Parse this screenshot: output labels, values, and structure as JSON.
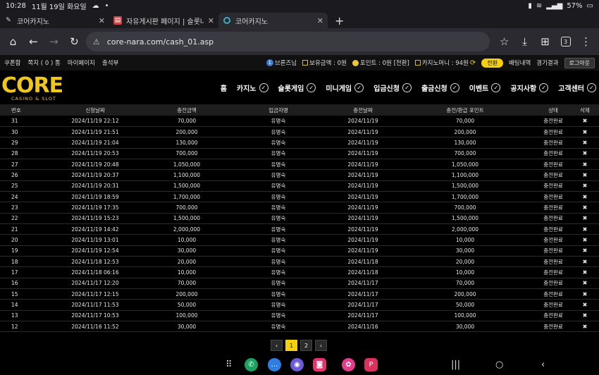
{
  "status": {
    "time": "10:28",
    "date": "11월 19일 화요일",
    "battery": "57%"
  },
  "tabs": [
    {
      "title": "코어카지노"
    },
    {
      "title": "자유게시판 페이지 | 슬롯나라 -"
    },
    {
      "title": "코어카지노"
    }
  ],
  "address": {
    "url": "core-nara.com/cash_01.asp",
    "tab_count": "3"
  },
  "sitebar": {
    "links": [
      "쿠폰함",
      "쪽지 ( 0 ) 통",
      "마이페이지",
      "출석부"
    ],
    "user": "브론즈님",
    "balance": "보유금액 : 0원",
    "points": "포인트 : 0원 [전환]",
    "casino_money": "카지노머니 : 94원",
    "convert": "전환",
    "bet_history": "배팅내역",
    "results": "경기결과",
    "logout": "로그아웃"
  },
  "logo": {
    "word": "CORE",
    "sub": "CASINO & SLOT"
  },
  "menu": [
    "홈",
    "카지노",
    "슬롯게임",
    "미니게임",
    "입금신청",
    "출금신청",
    "이벤트",
    "공지사항",
    "고객센터"
  ],
  "table": {
    "headers": [
      "번호",
      "신청날짜",
      "충전금액",
      "입금자명",
      "충전날짜",
      "충전/환급 포인트",
      "상태",
      "삭제"
    ],
    "rows": [
      {
        "no": "31",
        "req": "2024/11/19 22:12",
        "amount": "70,000",
        "name": "유명숙",
        "date": "2024/11/19",
        "point": "70,000",
        "status": "충전완료"
      },
      {
        "no": "30",
        "req": "2024/11/19 21:51",
        "amount": "200,000",
        "name": "유명숙",
        "date": "2024/11/19",
        "point": "200,000",
        "status": "충전완료"
      },
      {
        "no": "29",
        "req": "2024/11/19 21:04",
        "amount": "130,000",
        "name": "유명숙",
        "date": "2024/11/19",
        "point": "130,000",
        "status": "충전완료"
      },
      {
        "no": "28",
        "req": "2024/11/19 20:53",
        "amount": "700,000",
        "name": "유명숙",
        "date": "2024/11/19",
        "point": "700,000",
        "status": "충전완료"
      },
      {
        "no": "27",
        "req": "2024/11/19 20:48",
        "amount": "1,050,000",
        "name": "유명숙",
        "date": "2024/11/19",
        "point": "1,050,000",
        "status": "충전완료"
      },
      {
        "no": "26",
        "req": "2024/11/19 20:37",
        "amount": "1,100,000",
        "name": "유명숙",
        "date": "2024/11/19",
        "point": "1,100,000",
        "status": "충전완료"
      },
      {
        "no": "25",
        "req": "2024/11/19 20:31",
        "amount": "1,500,000",
        "name": "유명숙",
        "date": "2024/11/19",
        "point": "1,500,000",
        "status": "충전완료"
      },
      {
        "no": "24",
        "req": "2024/11/19 18:59",
        "amount": "1,700,000",
        "name": "유명숙",
        "date": "2024/11/19",
        "point": "1,700,000",
        "status": "충전완료"
      },
      {
        "no": "23",
        "req": "2024/11/19 17:35",
        "amount": "700,000",
        "name": "유명숙",
        "date": "2024/11/19",
        "point": "700,000",
        "status": "충전완료"
      },
      {
        "no": "22",
        "req": "2024/11/19 15:23",
        "amount": "1,500,000",
        "name": "유명숙",
        "date": "2024/11/19",
        "point": "1,500,000",
        "status": "충전완료"
      },
      {
        "no": "21",
        "req": "2024/11/19 14:42",
        "amount": "2,000,000",
        "name": "유명숙",
        "date": "2024/11/19",
        "point": "2,000,000",
        "status": "충전완료"
      },
      {
        "no": "20",
        "req": "2024/11/19 13:01",
        "amount": "10,000",
        "name": "유명숙",
        "date": "2024/11/19",
        "point": "10,000",
        "status": "충전완료"
      },
      {
        "no": "19",
        "req": "2024/11/19 12:54",
        "amount": "30,000",
        "name": "유명숙",
        "date": "2024/11/19",
        "point": "30,000",
        "status": "충전완료"
      },
      {
        "no": "18",
        "req": "2024/11/18 12:53",
        "amount": "20,000",
        "name": "유명숙",
        "date": "2024/11/18",
        "point": "20,000",
        "status": "충전완료"
      },
      {
        "no": "17",
        "req": "2024/11/18 06:16",
        "amount": "10,000",
        "name": "유명숙",
        "date": "2024/11/18",
        "point": "10,000",
        "status": "충전완료"
      },
      {
        "no": "16",
        "req": "2024/11/17 12:20",
        "amount": "70,000",
        "name": "유명숙",
        "date": "2024/11/17",
        "point": "70,000",
        "status": "충전완료"
      },
      {
        "no": "15",
        "req": "2024/11/17 12:15",
        "amount": "200,000",
        "name": "유명숙",
        "date": "2024/11/17",
        "point": "200,000",
        "status": "충전완료"
      },
      {
        "no": "14",
        "req": "2024/11/17 11:53",
        "amount": "50,000",
        "name": "유명숙",
        "date": "2024/11/17",
        "point": "50,000",
        "status": "충전완료"
      },
      {
        "no": "13",
        "req": "2024/11/17 10:53",
        "amount": "100,000",
        "name": "유명숙",
        "date": "2024/11/17",
        "point": "100,000",
        "status": "충전완료"
      },
      {
        "no": "12",
        "req": "2024/11/16 11:52",
        "amount": "30,000",
        "name": "유명숙",
        "date": "2024/11/16",
        "point": "30,000",
        "status": "충전완료"
      }
    ],
    "delete_glyph": "✖"
  },
  "pagination": {
    "prev": "‹",
    "pages": [
      "1",
      "2"
    ],
    "current": "1",
    "next": "›"
  },
  "colors": {
    "accent": "#f5d00f",
    "background": "#000000"
  }
}
